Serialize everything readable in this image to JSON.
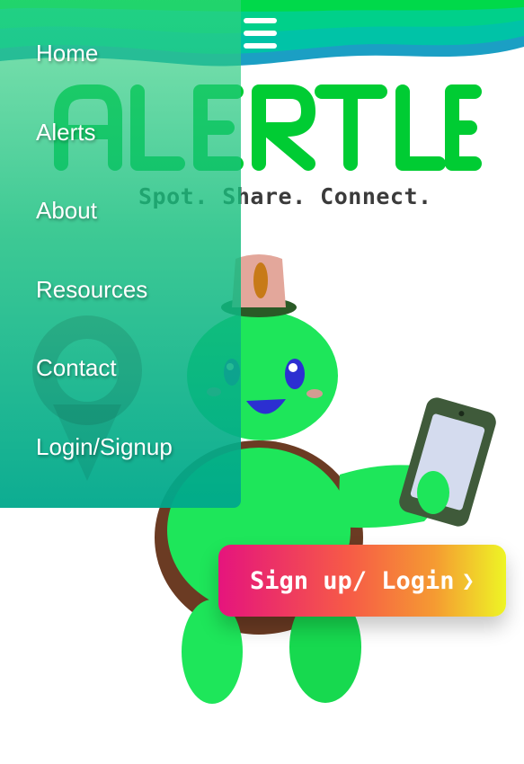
{
  "brand": {
    "logo_text": "ALERTLE",
    "tagline": "Spot. Share. Connect.",
    "primary_green": "#00cc33",
    "teal": "#00a88c"
  },
  "menu_toggle": {
    "icon": "hamburger-menu-icon"
  },
  "nav_drawer": {
    "items": [
      {
        "label": "Home"
      },
      {
        "label": "Alerts"
      },
      {
        "label": "About"
      },
      {
        "label": "Resources"
      },
      {
        "label": "Contact"
      },
      {
        "label": "Login/Signup"
      }
    ]
  },
  "hero": {
    "mascot": "turtle-mascot-holding-phone",
    "cta_label": "Sign up/ Login",
    "cta_icon": "chevron-right-icon",
    "cta_gradient": [
      "#e5147d",
      "#f65a47",
      "#f59a32",
      "#eef525"
    ]
  }
}
